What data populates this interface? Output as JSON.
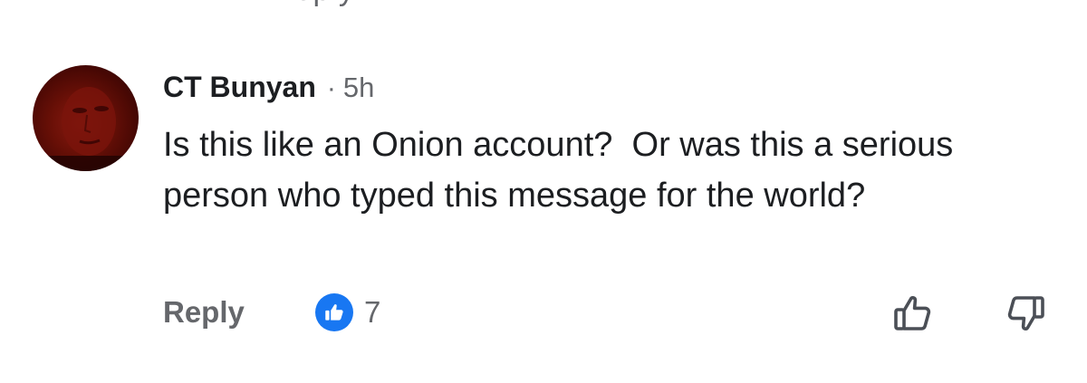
{
  "top_fragment": "Reply",
  "comment": {
    "author": "CT Bunyan",
    "separator": "·",
    "time": "5h",
    "text": "Is this like an Onion account?  Or was this a serious person who typed this message for the world?"
  },
  "actions": {
    "reply_label": "Reply",
    "reaction_count": "7",
    "reaction_icon": "like-icon",
    "upvote_icon": "thumbs-up-outline-icon",
    "downvote_icon": "thumbs-down-outline-icon"
  },
  "colors": {
    "text_primary": "#1c1e21",
    "text_secondary": "#65676b",
    "like_blue": "#1877f2",
    "background": "#ffffff"
  }
}
